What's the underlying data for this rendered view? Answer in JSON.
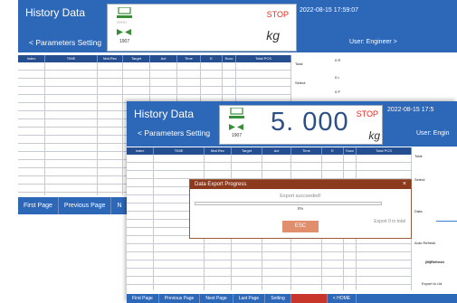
{
  "back_window": {
    "title": "History Data",
    "subnav": "< Parameters Setting",
    "status": "STOP",
    "unit": "kg",
    "tare": "1907",
    "zero_label": "ZERO",
    "datetime": "2022-08-15 17:59:07",
    "user": "User: Engineer >",
    "columns": [
      "Index",
      "TIME",
      "Mat.Rec",
      "Target",
      "Act",
      "Time",
      "E",
      "Succ",
      "Total PCS"
    ],
    "right_labels": {
      "total": "Total",
      "select": "Select:",
      "r1": "0 R",
      "r2": "0 L",
      "r3": "0 P",
      "r4": "0 L"
    },
    "bottom_nav": [
      "First Page",
      "Previous Page",
      "N"
    ]
  },
  "front_window": {
    "title": "History Data",
    "subnav": "< Parameters Setting",
    "weight": "5. 000",
    "status": "STOP",
    "unit": "kg",
    "tare": "1907",
    "datetime": "2022-08-15 17:5",
    "user": "User: Engin",
    "columns": [
      "Index",
      "TIME",
      "Mat.Rec",
      "Target",
      "Act",
      "Time",
      "E",
      "Succ",
      "Total PCS"
    ],
    "right_labels": {
      "total": "Total",
      "select": "Select:",
      "data": "Data",
      "auto_refresh": "Auto Refresh",
      "manual_refresh": "(M)Refresh",
      "export": "Export to Ud"
    },
    "bottom_nav": [
      "First Page",
      "Previous Page",
      "Next Page",
      "Last Page",
      "Setting",
      "",
      "< HOME"
    ]
  },
  "dialog": {
    "title": "Data Export Progress",
    "close": "×",
    "message": "Export succeeded!",
    "percent": "0%",
    "progress": 0,
    "count": "Export 0 in total",
    "esc_label": "ESC"
  }
}
